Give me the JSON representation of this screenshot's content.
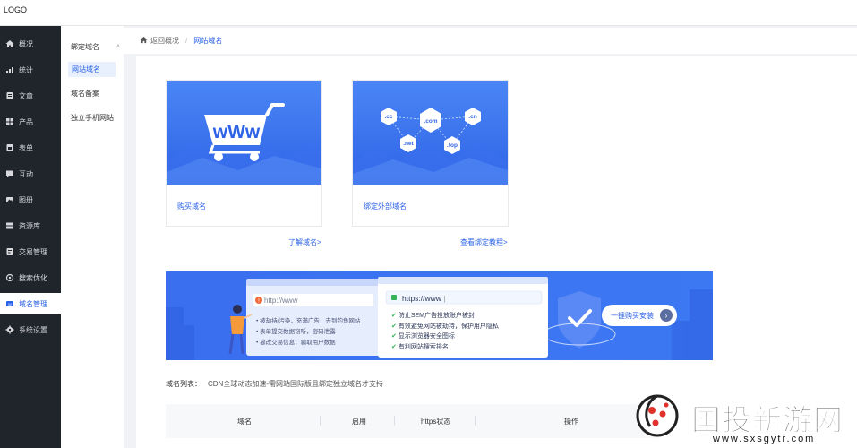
{
  "topbar": {
    "logo": "LOGO"
  },
  "sidebar": {
    "items": [
      {
        "label": "概况",
        "icon": "home-icon"
      },
      {
        "label": "统计",
        "icon": "chart-icon"
      },
      {
        "label": "文章",
        "icon": "article-icon"
      },
      {
        "label": "产品",
        "icon": "grid-icon"
      },
      {
        "label": "表单",
        "icon": "form-icon"
      },
      {
        "label": "互动",
        "icon": "chat-icon"
      },
      {
        "label": "图册",
        "icon": "album-icon"
      },
      {
        "label": "资源库",
        "icon": "database-icon"
      },
      {
        "label": "交易管理",
        "icon": "trade-icon"
      },
      {
        "label": "搜索优化",
        "icon": "search-optimize-icon"
      },
      {
        "label": "域名管理",
        "icon": "domain-icon",
        "active": true
      },
      {
        "label": "系统设置",
        "icon": "gear-icon"
      }
    ]
  },
  "subnav": {
    "group": "绑定域名",
    "active": "网站域名",
    "items": [
      "域名备案",
      "独立手机网站"
    ]
  },
  "breadcrumb": {
    "back": "返回概况",
    "separator": "/",
    "current": "网站域名"
  },
  "cards": [
    {
      "label": "购买域名",
      "link": "了解域名>"
    },
    {
      "label": "绑定外部域名",
      "link": "查看绑定教程>"
    }
  ],
  "card_illustration": {
    "www": "wWw",
    "tlds": [
      ".cc",
      ".com",
      ".cn",
      ".net",
      ".top"
    ]
  },
  "banner": {
    "http_url": "http://www",
    "http_items": [
      "被劫持/污染，充满广告，去到钓鱼网站",
      "表单提交数据窃听，密码泄露",
      "篡改交易信息，骗取用户数据"
    ],
    "https_url": "https://www",
    "https_items": [
      "防止SEM广告投放账户被封",
      "有效避免网站被劫持，保护用户隐私",
      "显示浏览器安全图标",
      "有利网站搜索排名"
    ],
    "button": "一键购买安装"
  },
  "domain_list": {
    "label": "域名列表：",
    "note": "CDN全球动态加速-需网站国际版且绑定独立域名才支持"
  },
  "table": {
    "headers": [
      "域名",
      "启用",
      "https状态",
      "操作"
    ]
  },
  "watermark": {
    "brand": "国投新游网",
    "url": "www.sxsgytr.com"
  },
  "colors": {
    "accent": "#2a62e8",
    "sidebar_bg": "#20242b",
    "banner_blue": "#3c71ee"
  }
}
